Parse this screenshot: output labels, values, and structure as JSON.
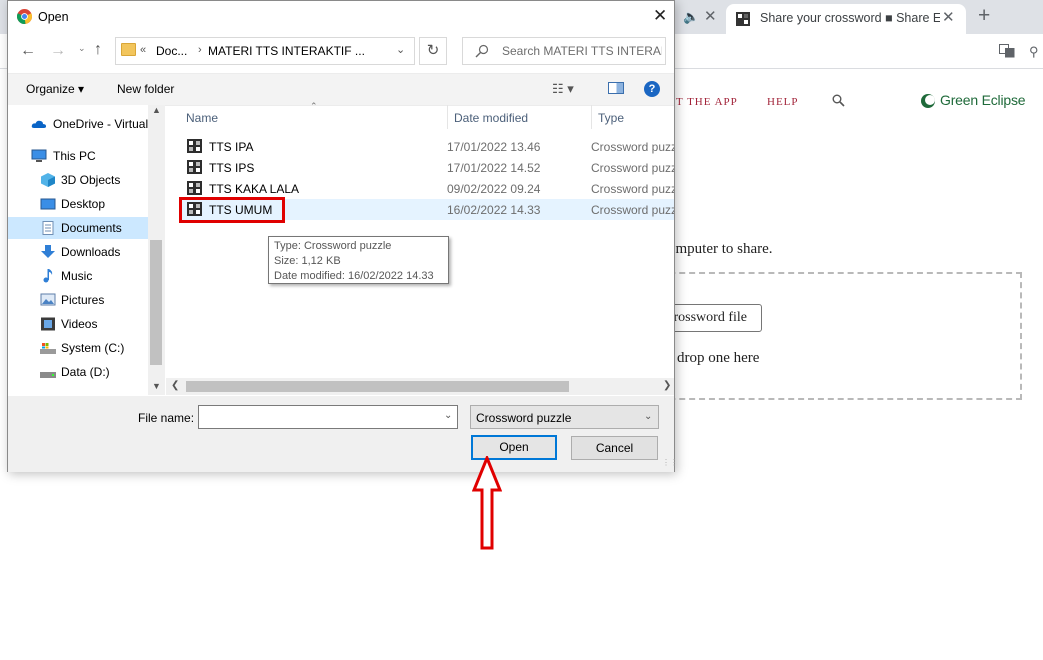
{
  "browser": {
    "active_tab_title": "Share your crossword ■ Share Ec",
    "new_tab_label": "+",
    "site_nav": {
      "app": "T THE APP",
      "help": "HELP"
    },
    "logo_text": "Green Eclipse",
    "share_text": "omputer to share.",
    "upload_button": "rossword file",
    "drop_text": "drop one here"
  },
  "dialog": {
    "title": "Open",
    "address": {
      "overflow": "«",
      "crumb1": "Doc...",
      "separator": "›",
      "crumb2": "MATERI TTS INTERAKTIF ..."
    },
    "search_placeholder": "Search MATERI TTS INTERAK...",
    "toolbar": {
      "organize": "Organize ▾",
      "new_folder": "New folder",
      "help": "?"
    },
    "nav_pane": [
      {
        "label": "OneDrive - Virtual",
        "icon": "onedrive-icon"
      },
      {
        "label": "This PC",
        "icon": "this-pc-icon"
      },
      {
        "label": "3D Objects",
        "icon": "3d-objects-icon"
      },
      {
        "label": "Desktop",
        "icon": "desktop-icon"
      },
      {
        "label": "Documents",
        "icon": "documents-icon",
        "selected": true
      },
      {
        "label": "Downloads",
        "icon": "downloads-icon"
      },
      {
        "label": "Music",
        "icon": "music-icon"
      },
      {
        "label": "Pictures",
        "icon": "pictures-icon"
      },
      {
        "label": "Videos",
        "icon": "videos-icon"
      },
      {
        "label": "System (C:)",
        "icon": "system-drive-icon"
      },
      {
        "label": "Data (D:)",
        "icon": "data-drive-icon"
      }
    ],
    "columns": {
      "name": "Name",
      "date": "Date modified",
      "type": "Type"
    },
    "files": [
      {
        "name": "TTS IPA",
        "date": "17/01/2022 13.46",
        "type": "Crossword puzzle"
      },
      {
        "name": "TTS IPS",
        "date": "17/01/2022 14.52",
        "type": "Crossword puzzle"
      },
      {
        "name": "TTS KAKA LALA",
        "date": "09/02/2022 09.24",
        "type": "Crossword puzzle"
      },
      {
        "name": "TTS UMUM",
        "date": "16/02/2022 14.33",
        "type": "Crossword puzzle",
        "selected": true
      }
    ],
    "tooltip": {
      "type": "Type: Crossword puzzle",
      "size": "Size: 1,12 KB",
      "date": "Date modified: 16/02/2022 14.33"
    },
    "file_name_label": "File name:",
    "file_name_value": "",
    "file_type": "Crossword puzzle",
    "open_label": "Open",
    "cancel_label": "Cancel"
  },
  "colors": {
    "accent": "#0078d7",
    "annotation": "#e00000",
    "site_red": "#a2243a",
    "logo_green": "#1f6a3a"
  }
}
